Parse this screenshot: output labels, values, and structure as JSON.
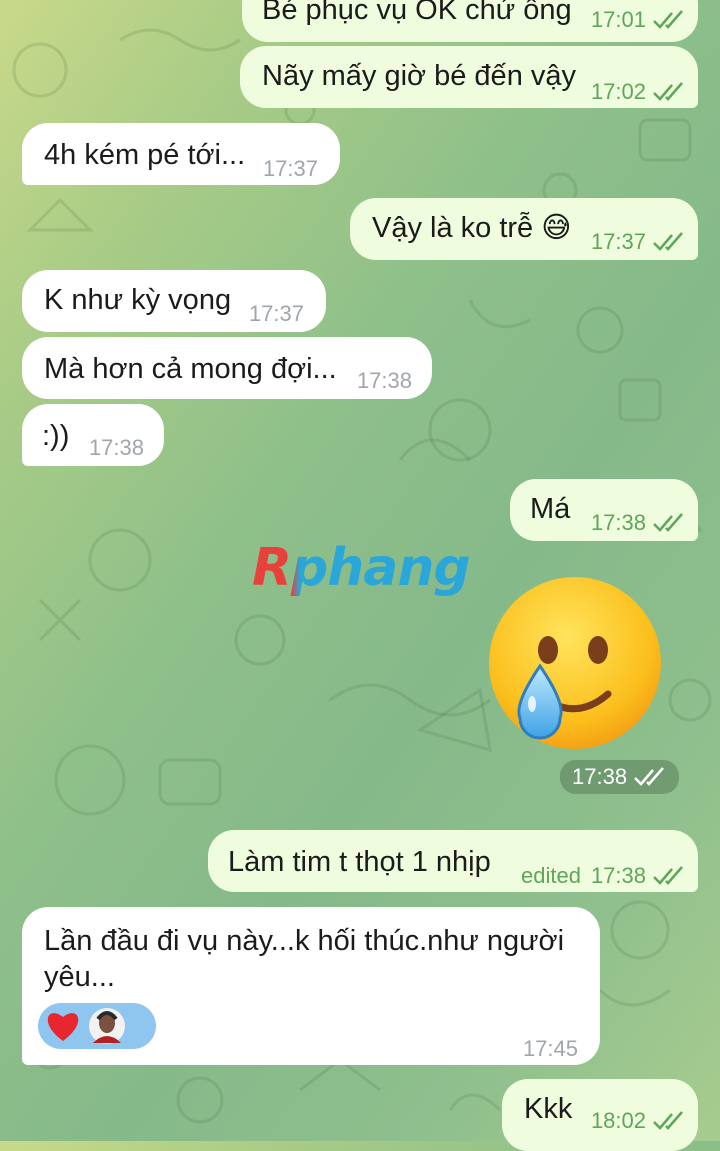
{
  "messages": [
    {
      "id": "m1",
      "dir": "out",
      "text": "Bé phục vụ OK chứ ông",
      "time": "17:01",
      "ticks": "double"
    },
    {
      "id": "m2",
      "dir": "out",
      "text": "Nãy mấy giờ bé đến vậy",
      "time": "17:02",
      "ticks": "double"
    },
    {
      "id": "m3",
      "dir": "in",
      "text": "4h kém pé tới...",
      "time": "17:37"
    },
    {
      "id": "m4",
      "dir": "out",
      "text": "Vậy là ko trễ 😅",
      "time": "17:37",
      "ticks": "double"
    },
    {
      "id": "m5",
      "dir": "in",
      "text": "K như kỳ vọng",
      "time": "17:37"
    },
    {
      "id": "m6",
      "dir": "in",
      "text": "Mà hơn cả mong đợi...",
      "time": "17:38"
    },
    {
      "id": "m7",
      "dir": "in",
      "text": ":))",
      "time": "17:38"
    },
    {
      "id": "m8",
      "dir": "out",
      "text": "Má",
      "time": "17:38",
      "ticks": "double"
    },
    {
      "id": "m9",
      "dir": "out",
      "type": "sticker",
      "emoji": "smiling-face-with-tear",
      "time": "17:38",
      "ticks": "double"
    },
    {
      "id": "m10",
      "dir": "out",
      "text": "Làm tim t thọt 1 nhịp",
      "edited_label": "edited",
      "time": "17:38",
      "ticks": "double"
    },
    {
      "id": "m11",
      "dir": "in",
      "text_line1": "Lần đầu đi vụ này...k hối thúc.như người",
      "text_line2": "yêu...",
      "time": "17:45",
      "reactions": [
        "heart-icon",
        "avatar"
      ]
    },
    {
      "id": "m12",
      "dir": "out",
      "text": "Kkk",
      "time": "18:02",
      "ticks": "double"
    }
  ],
  "watermark": {
    "text": "Rphang"
  },
  "colors": {
    "outgoing_bubble": "#effdde",
    "incoming_bubble": "#ffffff",
    "check_green": "#5fa55a",
    "meta_grey": "#a0a6ab",
    "reaction_bg": "#8fc6f0"
  }
}
